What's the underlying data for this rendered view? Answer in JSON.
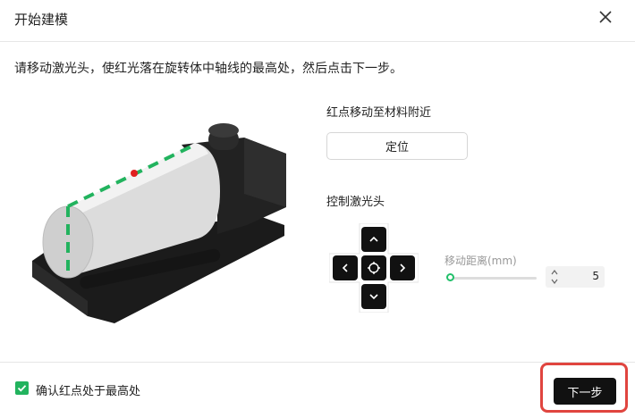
{
  "dialog": {
    "title": "开始建模",
    "close_icon": "close-icon"
  },
  "instruction": "请移动激光头，使红光落在旋转体中轴线的最高处，然后点击下一步。",
  "locate_section": {
    "label": "红点移动至材料附近",
    "button_label": "定位"
  },
  "control_section": {
    "label": "控制激光头",
    "buttons": [
      "arrow-up-icon",
      "arrow-left-icon",
      "home-icon",
      "arrow-right-icon",
      "arrow-down-icon"
    ]
  },
  "distance": {
    "label": "移动距离(mm)",
    "value": "5",
    "slider_fraction": 0.03,
    "accent_color": "#22c06a"
  },
  "footer": {
    "checkbox_label": "确认红点处于最高处",
    "checkbox_checked": true,
    "next_label": "下一步",
    "highlight_color": "#e0453f"
  }
}
